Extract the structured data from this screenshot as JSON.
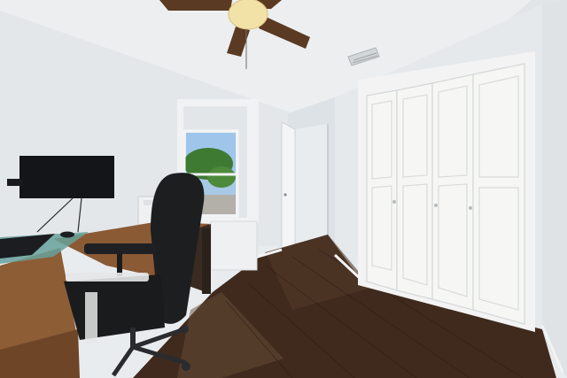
{
  "scene": {
    "subject": "home-office-bedroom",
    "colors": {
      "wall": "#e4e8eb",
      "wall_shadow": "#d3d8dc",
      "ceiling": "#eef0f1",
      "floor": "#3f2a1d",
      "floor_highlight": "#5e4331",
      "desk_wood": "#8a5a34",
      "closet_white": "#f4f5f3",
      "chair_black": "#1d1e20",
      "monitor_black": "#141518",
      "fan_blade": "#5a3a22",
      "fan_light": "#f3e2a8",
      "sky": "#9fc6ea",
      "tree": "#3f7a33"
    }
  }
}
